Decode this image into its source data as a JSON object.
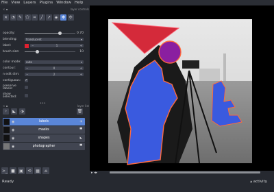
{
  "menubar": {
    "items": [
      "File",
      "View",
      "Layers",
      "Plugins",
      "Window",
      "Help"
    ]
  },
  "layer_controls": {
    "title": "layer controls",
    "tools": [
      "erase-icon",
      "fill-icon",
      "pick-icon",
      "polygon-icon",
      "rect-icon",
      "line-icon",
      "path-icon",
      "select-icon",
      "pan-zoom-icon",
      "move-icon"
    ],
    "opacity": {
      "label": "opacity:",
      "value": "0.70",
      "fraction": 0.7
    },
    "blending": {
      "label": "blending:",
      "value": "translucent"
    },
    "label": {
      "label": "label:",
      "value": "1"
    },
    "brush_size": {
      "label": "brush size:",
      "value": "10",
      "fraction": 0.25
    },
    "color_mode": {
      "label": "color mode:",
      "value": "auto"
    },
    "contour": {
      "label": "contour:",
      "value": "0"
    },
    "n_edit_dim": {
      "label": "n edit dim:",
      "value": "2"
    },
    "contiguous": {
      "label": "contiguous:",
      "checked": true
    },
    "preserve_labels": {
      "label": "preserve labels:",
      "checked": false
    },
    "show_selected": {
      "label": "show selected:",
      "checked": false
    }
  },
  "layer_list": {
    "title": "layer list",
    "layers": [
      {
        "name": "labels",
        "selected": true,
        "type_icon": "labels-icon"
      },
      {
        "name": "masks",
        "selected": false,
        "type_icon": "image-icon"
      },
      {
        "name": "shapes",
        "selected": false,
        "type_icon": "shapes-icon"
      },
      {
        "name": "photographer",
        "selected": false,
        "type_icon": "image-icon"
      }
    ]
  },
  "bottom_tools": [
    "console-icon",
    "square-icon",
    "grid-square-icon",
    "rotate-icon",
    "grid-icon",
    "home-icon"
  ],
  "status": {
    "text": "Ready",
    "activity": "▴ activity"
  },
  "colors": {
    "accent": "#5a86d8",
    "label_red": "#e02030",
    "label_blue": "#3a5adf"
  }
}
